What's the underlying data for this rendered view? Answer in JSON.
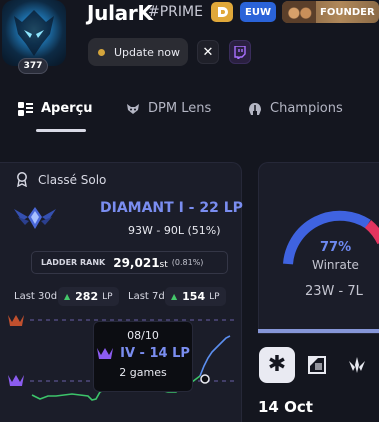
{
  "profile": {
    "name": "JularK",
    "tag": "#PRIME",
    "level": "377",
    "region": "EUW",
    "founder_label": "FOUNDER",
    "update_label": "Update now",
    "x_icon": "x-icon",
    "twitch_icon": "twitch-icon"
  },
  "tabs": [
    {
      "label": "Aperçu",
      "icon": "overview-icon",
      "active": true
    },
    {
      "label": "DPM Lens",
      "icon": "lens-icon",
      "active": false
    },
    {
      "label": "Champions",
      "icon": "helmet-icon",
      "active": false
    }
  ],
  "ranked": {
    "title": "Classé Solo",
    "rank": "DIAMANT I - 22 LP",
    "record": "93W - 90L (51%)",
    "ladder_label": "LADDER RANK",
    "ladder_value": "29,021",
    "ladder_suffix": "st",
    "ladder_pct": "(0.81%)",
    "last30_label": "Last 30d",
    "last30_value": "282",
    "last7_label": "Last 7d",
    "last7_value": "154",
    "lp_unit": "LP",
    "accent": "#7a8df0"
  },
  "tooltip": {
    "date": "08/10",
    "rank": "IV - 14 LP",
    "games": "2 games"
  },
  "winrate": {
    "pct": "77%",
    "label": "Winrate",
    "record": "23W - 7L",
    "win_fraction": 0.77
  },
  "filters": [
    {
      "icon": "asterisk-icon",
      "active": true
    },
    {
      "icon": "square-icon",
      "active": false
    },
    {
      "icon": "role-icon",
      "active": false
    }
  ],
  "date_header": "14 Oct"
}
